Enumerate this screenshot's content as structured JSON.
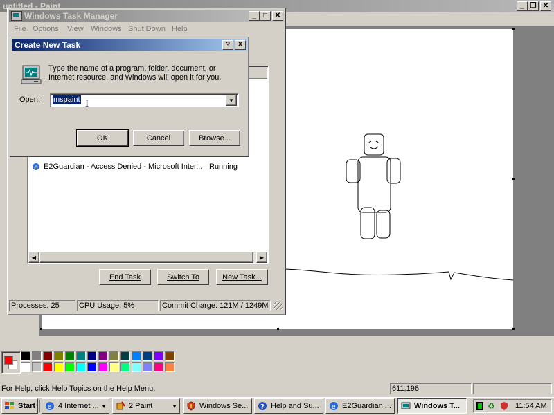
{
  "paint": {
    "title": "untitled - Paint",
    "status_help": "For Help, click Help Topics on the Help Menu.",
    "coords": "611,196",
    "palette": [
      "#000000",
      "#808080",
      "#800000",
      "#808000",
      "#008000",
      "#008080",
      "#000080",
      "#800080",
      "#808040",
      "#004040",
      "#0080ff",
      "#004080",
      "#8000ff",
      "#804000",
      "#ffffff",
      "#c0c0c0",
      "#ff0000",
      "#ffff00",
      "#00ff00",
      "#00ffff",
      "#0000ff",
      "#ff00ff",
      "#ffff80",
      "#00ff80",
      "#80ffff",
      "#8080ff",
      "#ff0080",
      "#ff8040"
    ],
    "foreground_color": "#ff0000",
    "background_color": "#ffffff"
  },
  "taskmgr": {
    "title": "Windows Task Manager",
    "menu": [
      "File",
      "Options",
      "View",
      "Windows",
      "Shut Down",
      "Help"
    ],
    "task_row": {
      "name": "E2Guardian - Access Denied - Microsoft Inter...",
      "status": "Running"
    },
    "buttons": {
      "end_task": "End Task",
      "switch_to": "Switch To",
      "new_task": "New Task..."
    },
    "status": {
      "processes": "Processes: 25",
      "cpu": "CPU Usage: 5%",
      "commit": "Commit Charge: 121M / 1249M"
    }
  },
  "dialog": {
    "title": "Create New Task",
    "help_btn": "?",
    "close_btn": "X",
    "description": "Type the name of a program, folder, document, or Internet resource, and Windows will open it for you.",
    "open_label": "Open:",
    "open_value": "mspaint",
    "ok": "OK",
    "cancel": "Cancel",
    "browse": "Browse..."
  },
  "taskbar": {
    "start": "Start",
    "tasks": [
      {
        "label": "4 Internet ...",
        "icon": "ie-icon"
      },
      {
        "label": "2 Paint",
        "icon": "paint-icon"
      },
      {
        "label": "Windows Se...",
        "icon": "shield-icon"
      },
      {
        "label": "Help and Su...",
        "icon": "help-icon"
      },
      {
        "label": "E2Guardian ...",
        "icon": "ie-icon"
      },
      {
        "label": "Windows T...",
        "icon": "taskmgr-icon"
      }
    ],
    "clock": "11:54 AM"
  }
}
